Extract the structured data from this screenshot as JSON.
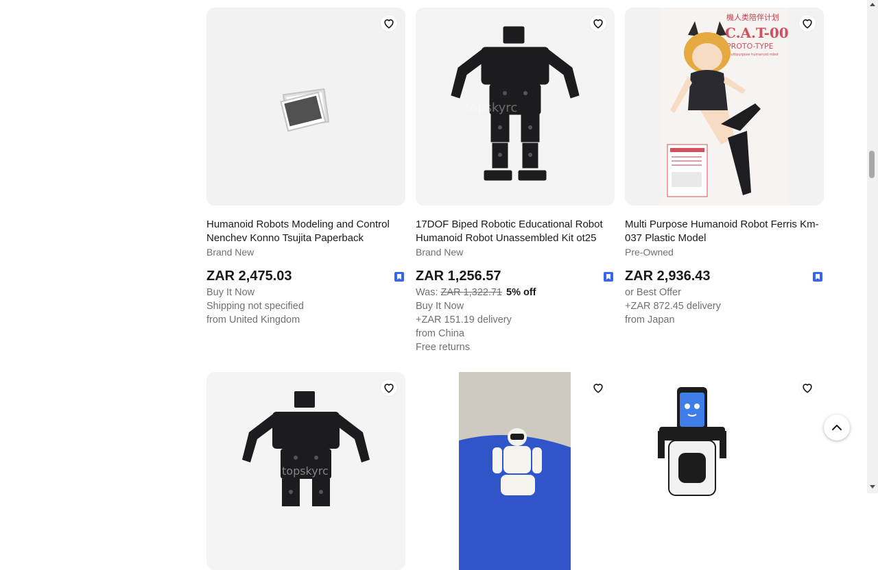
{
  "colors": {
    "accent": "#3665f3",
    "muted_text": "#707070",
    "card_bg": "#f2f2f2"
  },
  "listings": [
    {
      "title": "Humanoid Robots Modeling and Control Nenchev Konno Tsujita Paperback",
      "condition": "Brand New",
      "price": "ZAR 2,475.03",
      "details": [
        "Buy It Now",
        "Shipping not specified",
        "from United Kingdom"
      ],
      "image": "placeholder-photo-icon"
    },
    {
      "title": "17DOF Biped Robotic Educational Robot Humanoid Robot Unassembled Kit ot25",
      "condition": "Brand New",
      "price": "ZAR 1,256.57",
      "was_label": "Was: ",
      "was_price": "ZAR 1,322.71",
      "discount": "5% off",
      "details": [
        "Buy It Now",
        "+ZAR 151.19 delivery",
        "from China",
        "Free returns"
      ],
      "image": "biped-robot-kit"
    },
    {
      "title": "Multi Purpose Humanoid Robot Ferris Km-037 Plastic Model",
      "condition": "Pre-Owned",
      "price": "ZAR 2,936.43",
      "details": [
        "or Best Offer",
        "+ZAR 872.45 delivery",
        "from Japan"
      ],
      "image": "cat-00-model-box",
      "box_text": {
        "top": "機人类陪伴计划",
        "name": "C.A.T-00",
        "sub": "PROTO-TYPE",
        "desc": "Multipurpose humanoid robot"
      }
    }
  ],
  "row2_images": [
    "biped-robot-kit",
    "asimo-figure",
    "tablet-face-robot"
  ],
  "watermark": "topskyrc"
}
